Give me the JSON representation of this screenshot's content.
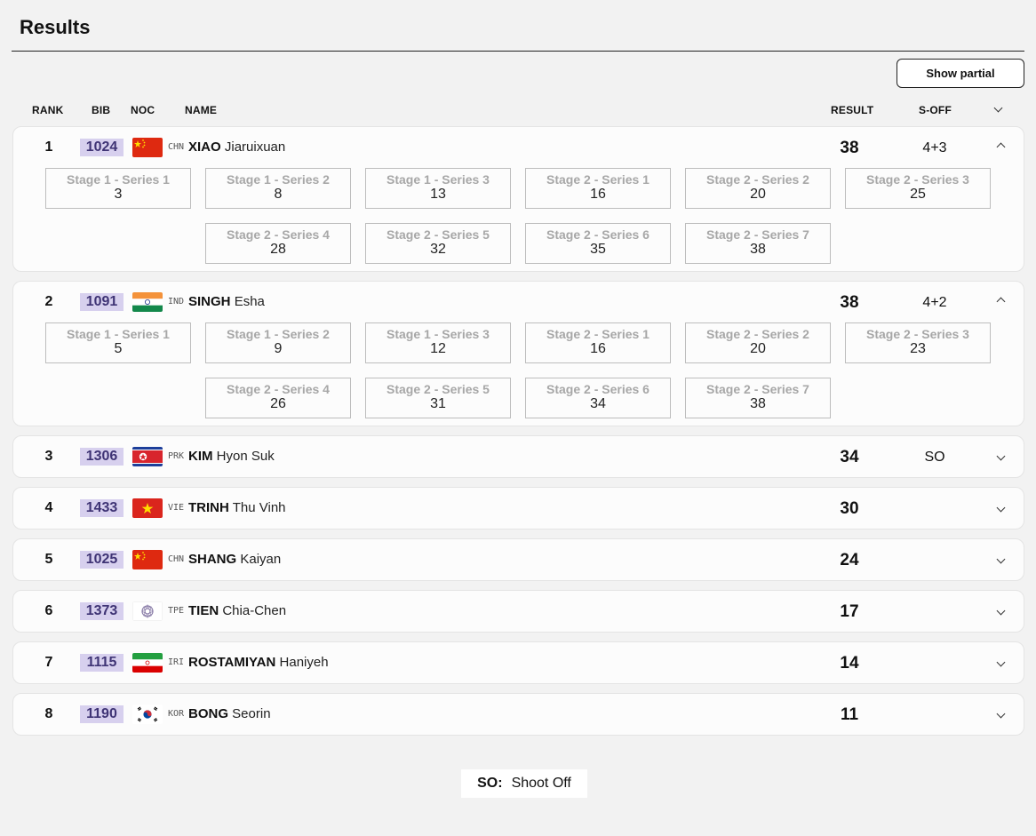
{
  "page": {
    "title": "Results",
    "show_partial_label": "Show partial"
  },
  "columns": {
    "rank": "RANK",
    "bib": "BIB",
    "noc": "NOC",
    "name": "NAME",
    "result": "RESULT",
    "soff": "S-OFF"
  },
  "athletes": [
    {
      "rank": "1",
      "bib": "1024",
      "noc": "CHN",
      "last": "XIAO",
      "first": "Jiaruixuan",
      "result": "38",
      "soff": "4+3",
      "expanded": true,
      "series": [
        {
          "label": "Stage 1 - Series 1",
          "value": "3"
        },
        {
          "label": "Stage 1 - Series 2",
          "value": "8"
        },
        {
          "label": "Stage 1 - Series 3",
          "value": "13"
        },
        {
          "label": "Stage 2 - Series 1",
          "value": "16"
        },
        {
          "label": "Stage 2 - Series 2",
          "value": "20"
        },
        {
          "label": "Stage 2 - Series 3",
          "value": "25"
        },
        {
          "label": "Stage 2 - Series 4",
          "value": "28"
        },
        {
          "label": "Stage 2 - Series 5",
          "value": "32"
        },
        {
          "label": "Stage 2 - Series 6",
          "value": "35"
        },
        {
          "label": "Stage 2 - Series 7",
          "value": "38"
        }
      ]
    },
    {
      "rank": "2",
      "bib": "1091",
      "noc": "IND",
      "last": "SINGH",
      "first": "Esha",
      "result": "38",
      "soff": "4+2",
      "expanded": true,
      "series": [
        {
          "label": "Stage 1 - Series 1",
          "value": "5"
        },
        {
          "label": "Stage 1 - Series 2",
          "value": "9"
        },
        {
          "label": "Stage 1 - Series 3",
          "value": "12"
        },
        {
          "label": "Stage 2 - Series 1",
          "value": "16"
        },
        {
          "label": "Stage 2 - Series 2",
          "value": "20"
        },
        {
          "label": "Stage 2 - Series 3",
          "value": "23"
        },
        {
          "label": "Stage 2 - Series 4",
          "value": "26"
        },
        {
          "label": "Stage 2 - Series 5",
          "value": "31"
        },
        {
          "label": "Stage 2 - Series 6",
          "value": "34"
        },
        {
          "label": "Stage 2 - Series 7",
          "value": "38"
        }
      ]
    },
    {
      "rank": "3",
      "bib": "1306",
      "noc": "PRK",
      "last": "KIM",
      "first": "Hyon Suk",
      "result": "34",
      "soff": "SO",
      "expanded": false
    },
    {
      "rank": "4",
      "bib": "1433",
      "noc": "VIE",
      "last": "TRINH",
      "first": "Thu Vinh",
      "result": "30",
      "soff": "",
      "expanded": false
    },
    {
      "rank": "5",
      "bib": "1025",
      "noc": "CHN",
      "last": "SHANG",
      "first": "Kaiyan",
      "result": "24",
      "soff": "",
      "expanded": false
    },
    {
      "rank": "6",
      "bib": "1373",
      "noc": "TPE",
      "last": "TIEN",
      "first": "Chia-Chen",
      "result": "17",
      "soff": "",
      "expanded": false
    },
    {
      "rank": "7",
      "bib": "1115",
      "noc": "IRI",
      "last": "ROSTAMIYAN",
      "first": "Haniyeh",
      "result": "14",
      "soff": "",
      "expanded": false
    },
    {
      "rank": "8",
      "bib": "1190",
      "noc": "KOR",
      "last": "BONG",
      "first": "Seorin",
      "result": "11",
      "soff": "",
      "expanded": false
    }
  ],
  "legend": {
    "abbr": "SO:",
    "text": "Shoot Off"
  },
  "icons": {
    "expand": "chevron-down-icon",
    "collapse": "chevron-up-icon"
  },
  "colors": {
    "bib_bg": "#d7d0ee",
    "bib_text": "#3f3475"
  }
}
